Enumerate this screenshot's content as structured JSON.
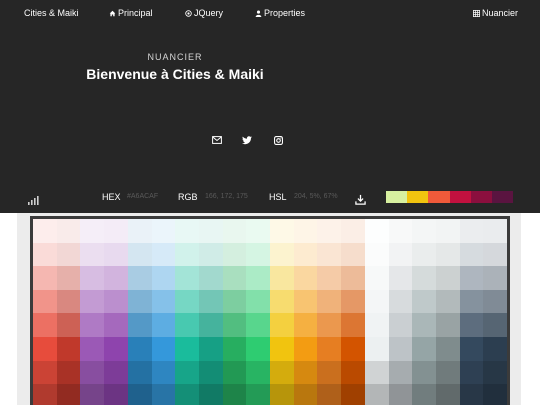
{
  "nav": {
    "brand": "Cities & Maiki",
    "items": [
      {
        "label": "Principal",
        "icon": "home-icon"
      },
      {
        "label": "JQuery",
        "icon": "globe-icon"
      },
      {
        "label": "Properties",
        "icon": "user-icon"
      },
      {
        "label": "Nuancier",
        "icon": "table-icon"
      }
    ]
  },
  "hero": {
    "subtitle": "NUANCIER",
    "title": "Bienvenue à Cities & Maiki",
    "social": [
      "mail-icon",
      "twitter-icon",
      "instagram-icon"
    ]
  },
  "toolbar": {
    "hex_label": "HEX",
    "hex_value": "#A6ACAF",
    "rgb_label": "RGB",
    "rgb_value": "166, 172, 175",
    "hsl_label": "HSL",
    "hsl_value": "204, 5%, 67%",
    "selection": [
      "#d7f0a0",
      "#f1c40f",
      "#f05a3a",
      "#c2113f",
      "#8b0f3e",
      "#5a1440"
    ]
  },
  "palette": {
    "columns": [
      [
        "#fdedec",
        "#fadbd8",
        "#f5b7b1",
        "#f1948a",
        "#ec7063",
        "#e74c3c",
        "#cb4335",
        "#b03a2e"
      ],
      [
        "#f9ebea",
        "#f2d7d5",
        "#e6b0aa",
        "#d98880",
        "#cd6155",
        "#c0392b",
        "#a93226",
        "#922b21"
      ],
      [
        "#f5eef8",
        "#ebdef0",
        "#d7bde2",
        "#c39bd3",
        "#af7ac5",
        "#9b59b6",
        "#884ea0",
        "#76448a"
      ],
      [
        "#f4ecf7",
        "#e8daef",
        "#d2b4de",
        "#bb8fce",
        "#a569bd",
        "#8e44ad",
        "#7d3c98",
        "#6c3483"
      ],
      [
        "#eaf2f8",
        "#d4e6f1",
        "#a9cce3",
        "#7fb3d5",
        "#5499c7",
        "#2980b9",
        "#2471a3",
        "#1f618d"
      ],
      [
        "#ebf5fb",
        "#d6eaf8",
        "#aed6f1",
        "#85c1e9",
        "#5dade2",
        "#3498db",
        "#2e86c1",
        "#2874a6"
      ],
      [
        "#e8f8f5",
        "#d1f2eb",
        "#a3e4d7",
        "#76d7c4",
        "#48c9b0",
        "#1abc9c",
        "#17a589",
        "#148f77"
      ],
      [
        "#e8f6f3",
        "#d0ece7",
        "#a2d9ce",
        "#73c6b6",
        "#45b39d",
        "#16a085",
        "#138d75",
        "#117a65"
      ],
      [
        "#e9f7ef",
        "#d4efdf",
        "#a9dfbf",
        "#7dcea0",
        "#52be80",
        "#27ae60",
        "#229954",
        "#1e8449"
      ],
      [
        "#eafaf1",
        "#d5f5e3",
        "#abebc6",
        "#82e0aa",
        "#58d68d",
        "#2ecc71",
        "#28b463",
        "#239b56"
      ],
      [
        "#fef9e7",
        "#fcf3cf",
        "#f9e79f",
        "#f7dc6f",
        "#f4d03f",
        "#f1c40f",
        "#d4ac0d",
        "#b7950b"
      ],
      [
        "#fef5e7",
        "#fdebd0",
        "#fad7a0",
        "#f8c471",
        "#f5b041",
        "#f39c12",
        "#d68910",
        "#b9770e"
      ],
      [
        "#fdf2e9",
        "#fae5d3",
        "#f5cba7",
        "#f0b27a",
        "#eb984e",
        "#e67e22",
        "#ca6f1e",
        "#af601a"
      ],
      [
        "#fbeee6",
        "#f6ddcc",
        "#edbb99",
        "#e59866",
        "#dc7633",
        "#d35400",
        "#ba4a00",
        "#a04000"
      ],
      [
        "#fdfefe",
        "#fbfcfc",
        "#f7f9f9",
        "#f4f6f7",
        "#f0f3f4",
        "#ecf0f1",
        "#d0d3d4",
        "#b3b6b7"
      ],
      [
        "#f8f9f9",
        "#f2f3f4",
        "#e5e7e9",
        "#d7dbdd",
        "#cacfd2",
        "#bdc3c7",
        "#a6acaf",
        "#909497"
      ],
      [
        "#f4f6f6",
        "#eaeded",
        "#d5dbdb",
        "#bfc9ca",
        "#aab7b8",
        "#95a5a6",
        "#839192",
        "#717d7e"
      ],
      [
        "#f2f4f4",
        "#e5e8e8",
        "#ccd1d1",
        "#b2babb",
        "#99a3a4",
        "#7f8c8d",
        "#707b7c",
        "#616a6b"
      ],
      [
        "#ebedef",
        "#d6dbdf",
        "#aeb6bf",
        "#85929e",
        "#5d6d7e",
        "#34495e",
        "#2e4053",
        "#283747"
      ],
      [
        "#eaecee",
        "#d5d8dc",
        "#abb2b9",
        "#808b96",
        "#566573",
        "#2c3e50",
        "#273746",
        "#212f3d"
      ]
    ]
  }
}
